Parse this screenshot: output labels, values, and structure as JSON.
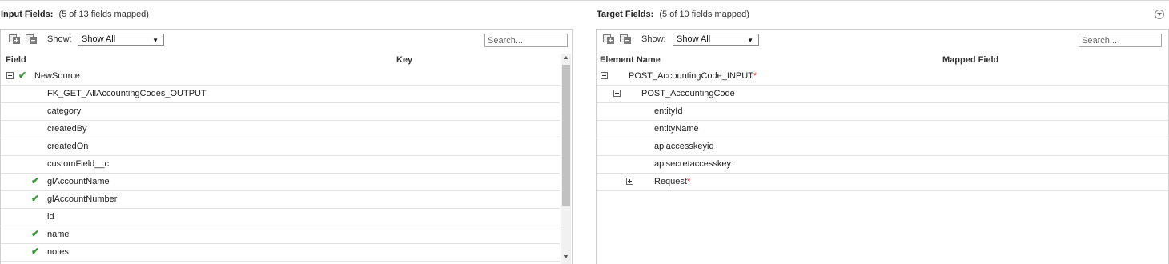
{
  "left": {
    "title": "Input Fields:",
    "subtitle": "(5 of 13 fields mapped)",
    "show_label": "Show:",
    "show_value": "Show All",
    "search_placeholder": "Search...",
    "columns": [
      "Field",
      "Key"
    ],
    "root": {
      "label": "NewSource",
      "mapped": true,
      "expanded": true
    },
    "rows": [
      {
        "label": "FK_GET_AllAccountingCodes_OUTPUT",
        "mapped": false
      },
      {
        "label": "category",
        "mapped": false
      },
      {
        "label": "createdBy",
        "mapped": false
      },
      {
        "label": "createdOn",
        "mapped": false
      },
      {
        "label": "customField__c",
        "mapped": false
      },
      {
        "label": "glAccountName",
        "mapped": true
      },
      {
        "label": "glAccountNumber",
        "mapped": true
      },
      {
        "label": "id",
        "mapped": false
      },
      {
        "label": "name",
        "mapped": true
      },
      {
        "label": "notes",
        "mapped": true
      }
    ]
  },
  "right": {
    "title": "Target Fields:",
    "subtitle": "(5 of 10 fields mapped)",
    "show_label": "Show:",
    "show_value": "Show All",
    "search_placeholder": "Search...",
    "columns": [
      "Element Name",
      "Mapped Field"
    ],
    "rows": [
      {
        "label": "POST_AccountingCode_INPUT",
        "required": "*",
        "toggle": "minus"
      },
      {
        "label": "POST_AccountingCode",
        "required": "",
        "toggle": "minus"
      },
      {
        "label": "entityId",
        "required": ""
      },
      {
        "label": "entityName",
        "required": ""
      },
      {
        "label": "apiaccesskeyid",
        "required": ""
      },
      {
        "label": "apisecretaccesskey",
        "required": ""
      },
      {
        "label": "Request",
        "required": "*",
        "toggle": "plus"
      }
    ]
  },
  "icons": {
    "expand_all": "expand-all-icon",
    "collapse_all": "collapse-all-icon",
    "check": "check-icon",
    "panel_collapse": "chevron-down-circle-icon"
  },
  "colors": {
    "check": "#2e9a2e",
    "required": "#dd2222",
    "toolbar_icon": "#7a7a7a"
  }
}
